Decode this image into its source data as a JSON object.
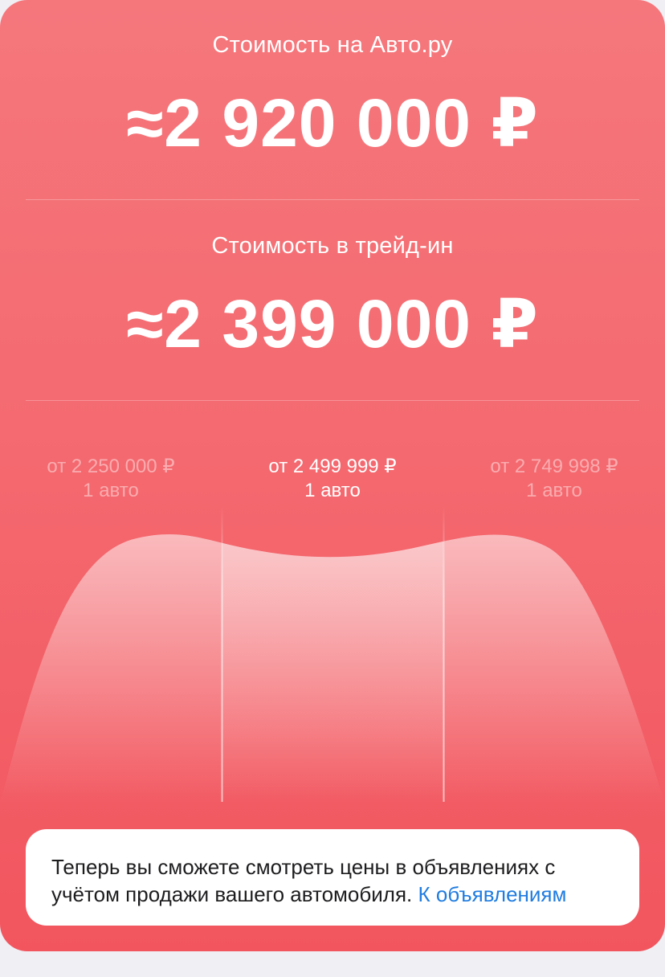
{
  "market": {
    "label": "Стоимость на Авто.ру",
    "price": "≈2 920 000 ₽"
  },
  "tradein": {
    "label": "Стоимость в трейд-ин",
    "price": "≈2 399 000 ₽"
  },
  "distribution": {
    "bins": [
      {
        "price": "от 2 250 000 ₽",
        "count": "1 авто",
        "active": false
      },
      {
        "price": "от 2 499 999 ₽",
        "count": "1 авто",
        "active": true
      },
      {
        "price": "от 2 749 998 ₽",
        "count": "1 авто",
        "active": false
      }
    ]
  },
  "notice": {
    "text": "Теперь вы сможете смотреть цены в объявлениях с учётом продажи вашего автомобиля.",
    "link": "К объявлениям"
  },
  "colors": {
    "accent_top": "#f5777c",
    "accent_bottom": "#f2555e",
    "link": "#1f7ce0"
  }
}
